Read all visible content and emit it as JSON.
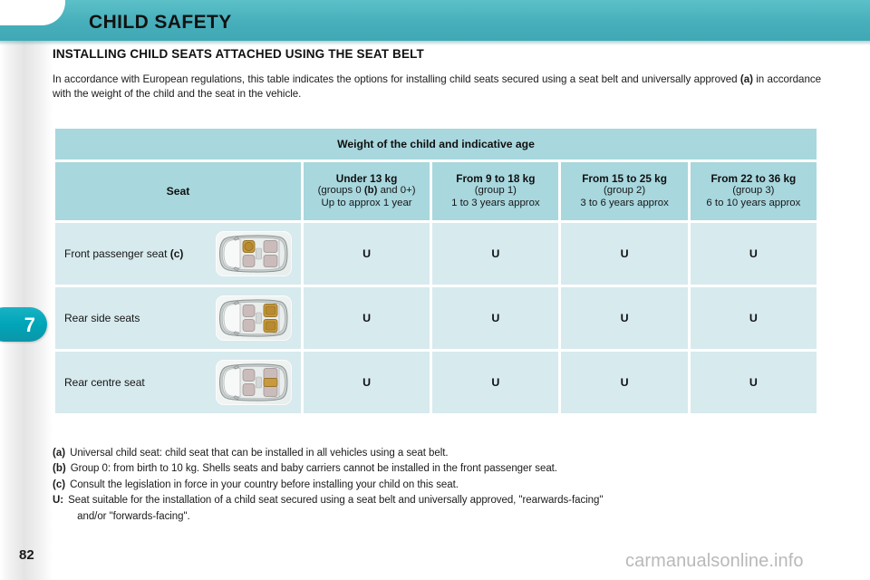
{
  "header": {
    "title": "CHILD SAFETY",
    "banner_color": "#46afbb"
  },
  "chapter": {
    "number": "7",
    "tab_color": "#00a5b8"
  },
  "page_number": "82",
  "watermark": "carmanualsonline.info",
  "section": {
    "title": "INSTALLING CHILD SEATS ATTACHED USING THE SEAT BELT",
    "intro_part1": "In accordance with European regulations, this table indicates the options for installing child seats secured using a seat belt and universally approved ",
    "intro_bold": "(a)",
    "intro_part2": " in accordance with the weight of the child and the seat in the vehicle."
  },
  "table": {
    "header_color": "#a8d7de",
    "cell_color": "#d7eaee",
    "super_header": "Weight of the child and indicative age",
    "seat_column_header": "Seat",
    "weight_columns": [
      {
        "line1": "Under 13 kg",
        "line2": "(groups 0 (b) and 0+)",
        "line2_pre": "(groups 0 ",
        "line2_bold": "(b)",
        "line2_post": " and 0+)",
        "line3": "Up to approx 1 year"
      },
      {
        "line1": "From 9 to 18 kg",
        "line2": "(group 1)",
        "line3": "1 to 3 years approx"
      },
      {
        "line1": "From 15 to 25 kg",
        "line2": "(group 2)",
        "line3": "3 to 6 years approx"
      },
      {
        "line1": "From 22 to 36 kg",
        "line2": "(group 3)",
        "line3": "6 to 10 years approx"
      }
    ],
    "rows": [
      {
        "label": "Front passenger seat ",
        "label_bold": "(c)",
        "icon": "car-front-passenger-seat-icon",
        "highlight": "front-passenger",
        "values": [
          "U",
          "U",
          "U",
          "U"
        ]
      },
      {
        "label": "Rear side seats",
        "label_bold": "",
        "icon": "car-rear-side-seats-icon",
        "highlight": "rear-sides",
        "values": [
          "U",
          "U",
          "U",
          "U"
        ]
      },
      {
        "label": "Rear centre seat",
        "label_bold": "",
        "icon": "car-rear-centre-seat-icon",
        "highlight": "rear-centre",
        "values": [
          "U",
          "U",
          "U",
          "U"
        ]
      }
    ]
  },
  "footnotes": [
    {
      "key": "(a)",
      "text": "Universal child seat: child seat that can be installed in all vehicles using a seat belt."
    },
    {
      "key": "(b)",
      "text": "Group 0: from birth to 10 kg. Shells seats and baby carriers cannot be installed in the front passenger seat."
    },
    {
      "key": "(c)",
      "text": "Consult the legislation in force in your country before installing your child on this seat."
    },
    {
      "key": "U:",
      "text": "Seat suitable for the installation of a child seat secured using a seat belt and universally approved, \"rearwards-facing\"",
      "text2": "and/or \"forwards-facing\"."
    }
  ]
}
